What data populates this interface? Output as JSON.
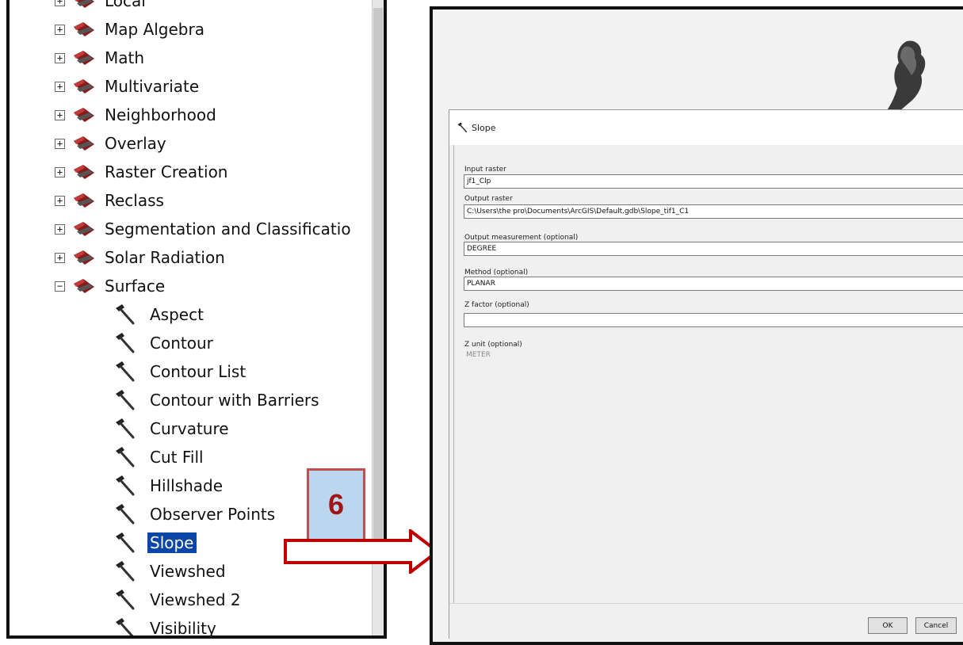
{
  "toolbox": {
    "categories": [
      {
        "label": "Local",
        "state": "+"
      },
      {
        "label": "Map Algebra",
        "state": "+"
      },
      {
        "label": "Math",
        "state": "+"
      },
      {
        "label": "Multivariate",
        "state": "+"
      },
      {
        "label": "Neighborhood",
        "state": "+"
      },
      {
        "label": "Overlay",
        "state": "+"
      },
      {
        "label": "Raster Creation",
        "state": "+"
      },
      {
        "label": "Reclass",
        "state": "+"
      },
      {
        "label": "Segmentation and Classificatio",
        "state": "+"
      },
      {
        "label": "Solar Radiation",
        "state": "+"
      },
      {
        "label": "Surface",
        "state": "−"
      }
    ],
    "tools": [
      "Aspect",
      "Contour",
      "Contour List",
      "Contour with Barriers",
      "Curvature",
      "Cut Fill",
      "Hillshade",
      "Observer Points",
      "Slope",
      "Viewshed",
      "Viewshed 2",
      "Visibility"
    ],
    "selected_tool": "Slope",
    "icons": {
      "category": "toolbox-icon",
      "tool": "hammer-icon"
    }
  },
  "step_badge": "6",
  "colors": {
    "selection": "#0a46a5",
    "badge_border": "#c0504d",
    "badge_fill": "#bcd6ef",
    "arrow": "#c00000"
  },
  "dialog": {
    "title": "Slope",
    "fields": [
      {
        "label": "Input raster",
        "value": "jf1_Clp"
      },
      {
        "label": "Output raster",
        "value": "C:\\Users\\the pro\\Documents\\ArcGIS\\Default.gdb\\Slope_tif1_C1"
      },
      {
        "label": "Output measurement (optional)",
        "value": "DEGREE"
      },
      {
        "label": "Method (optional)",
        "value": "PLANAR"
      },
      {
        "label": "Z factor (optional)",
        "value": ""
      },
      {
        "label": "Z unit (optional)",
        "value": "METER"
      }
    ],
    "buttons": {
      "ok": "OK",
      "cancel": "Cancel"
    }
  }
}
